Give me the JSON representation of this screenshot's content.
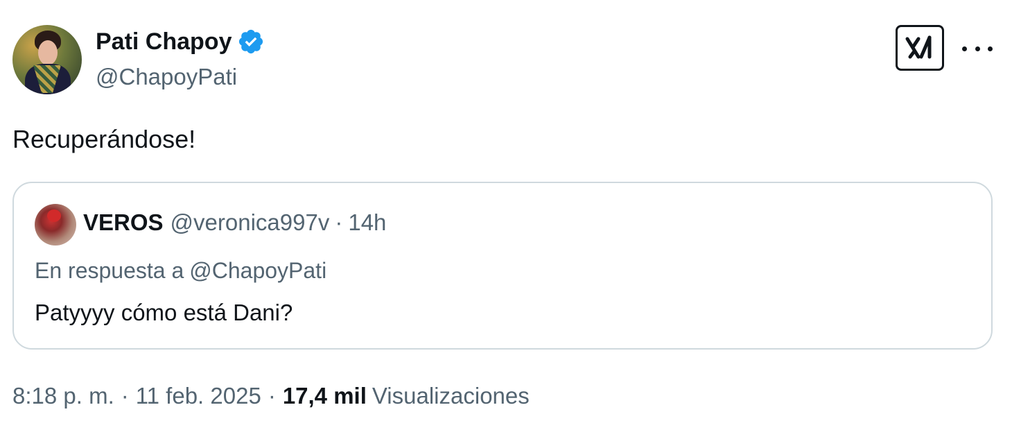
{
  "author": {
    "display_name": "Pati Chapoy",
    "handle": "@ChapoyPati",
    "verified": true
  },
  "tweet": {
    "text": "Recuperándose!"
  },
  "quoted_tweet": {
    "display_name": "VEROS",
    "handle": "@veronica997v",
    "separator": "·",
    "time": "14h",
    "reply_prefix": "En respuesta a",
    "reply_to": "@ChapoyPati",
    "text": "Patyyyy cómo está Dani?"
  },
  "meta": {
    "time": "8:18 p. m.",
    "separator": "·",
    "date": "11 feb. 2025",
    "views_count": "17,4 mil",
    "views_label": "Visualizaciones"
  },
  "icons": {
    "verified": "verified-badge-icon",
    "grok": "grok-icon",
    "more": "more-options-icon"
  },
  "colors": {
    "verified_blue": "#1d9bf0",
    "primary_text": "#0f1419",
    "secondary_text": "#536471",
    "border": "#cfd9de"
  }
}
